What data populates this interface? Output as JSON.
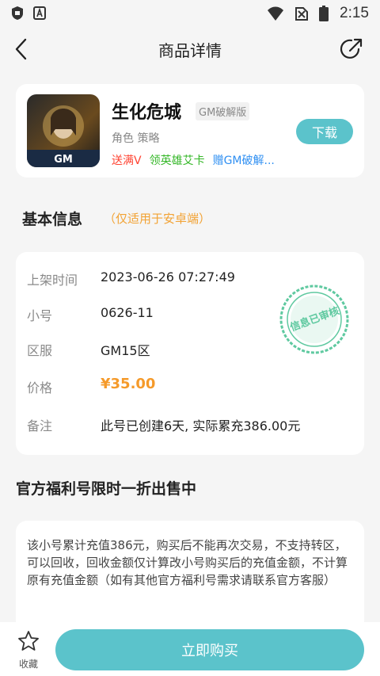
{
  "status_bar": {
    "time": "2:15"
  },
  "nav": {
    "title": "商品详情"
  },
  "game": {
    "name": "生化危城",
    "tag": "GM破解版",
    "categories": "角色 策略",
    "perks": [
      "送满V",
      "领英雄艾卡",
      "赠GM破解..."
    ],
    "download_label": "下载"
  },
  "basic_info": {
    "title": "基本信息",
    "subtitle": "（仅适用于安卓端）",
    "rows": [
      {
        "label": "上架时间",
        "value": "2023-06-26 07:27:49"
      },
      {
        "label": "小号",
        "value": "0626-11"
      },
      {
        "label": "区服",
        "value": "GM15区"
      },
      {
        "label": "价格",
        "value": "¥35.00"
      },
      {
        "label": "备注",
        "value": "此号已创建6天, 实际累充386.00元"
      }
    ],
    "stamp_text": "信息已审核"
  },
  "welfare": {
    "title": "官方福利号限时一折出售中",
    "description": "该小号累计充值386元，购买后不能再次交易，不支持转区，可以回收，回收金额仅计算改小号购买后的充值金额，不计算原有充值金额（如有其他官方福利号需求请联系官方客服）"
  },
  "bottom": {
    "favorite_label": "收藏",
    "buy_label": "立即购买"
  },
  "colors": {
    "accent": "#5bc3cb",
    "price": "#f59a2a",
    "stamp": "#5fc9a0",
    "subtitle": "#f2a233"
  }
}
